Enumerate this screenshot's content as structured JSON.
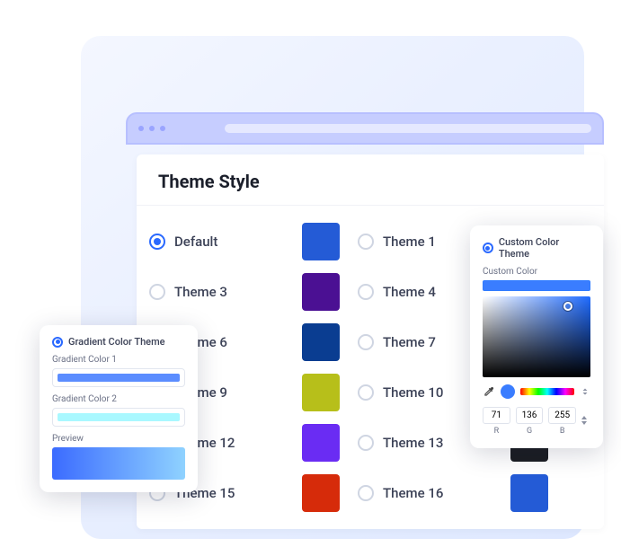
{
  "main": {
    "title": "Theme Style",
    "themes": [
      {
        "name": "Default",
        "color": "#245bd6",
        "selected": true
      },
      {
        "name": "Theme 1",
        "color": null,
        "selected": false
      },
      {
        "name": "Theme 3",
        "color": "#4b1093",
        "selected": false
      },
      {
        "name": "Theme 4",
        "color": null,
        "selected": false
      },
      {
        "name": "Theme 6",
        "color": "#0a3d91",
        "selected": false
      },
      {
        "name": "Theme 7",
        "color": null,
        "selected": false
      },
      {
        "name": "Theme 9",
        "color": "#b7bf1a",
        "selected": false
      },
      {
        "name": "Theme 10",
        "color": null,
        "selected": false
      },
      {
        "name": "Theme 12",
        "color": "#6a2cf3",
        "selected": false
      },
      {
        "name": "Theme 13",
        "color": "#1b1d22",
        "selected": false
      },
      {
        "name": "Theme 15",
        "color": "#d62b0a",
        "selected": false
      },
      {
        "name": "Theme 16",
        "color": "#245bd6",
        "selected": false
      }
    ]
  },
  "gradient": {
    "title": "Gradient Color Theme",
    "label1": "Gradient Color 1",
    "label2": "Gradient Color 2",
    "preview_label": "Preview",
    "color1": "#5b8dff",
    "color2": "#a9f8ff",
    "preview_from": "#3b6bff",
    "preview_to": "#8fd2ff"
  },
  "custom": {
    "title": "Custom Color Theme",
    "label": "Custom Color",
    "rgb": {
      "r": "71",
      "g": "136",
      "b": "255"
    },
    "r_label": "R",
    "g_label": "G",
    "b_label": "B",
    "hue_base": "#1f6bff"
  }
}
